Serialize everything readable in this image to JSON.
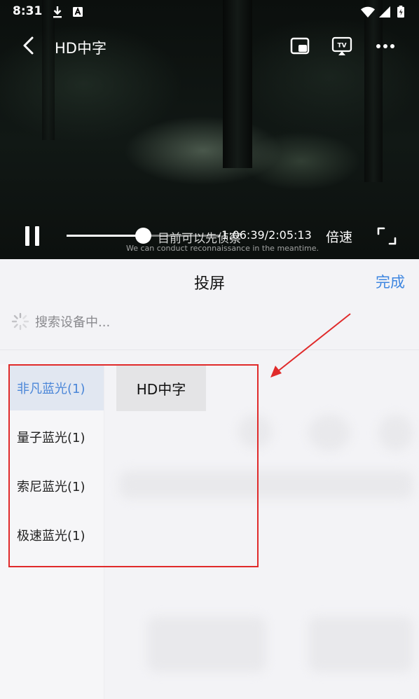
{
  "status_bar": {
    "time": "8:31"
  },
  "video": {
    "title": "HD中字",
    "subtitle_cn": "目前可以先侦察",
    "subtitle_en": "We can conduct reconnaissance in the meantime.",
    "current_time": "1:06:39",
    "duration": "2:05:13",
    "timecode": "1:06:39/2:05:13",
    "progress": 0.5326,
    "speed_label": "倍速"
  },
  "cast_sheet": {
    "title": "投屏",
    "done_label": "完成",
    "searching_text": "搜索设备中...",
    "categories": [
      {
        "label": "非凡蓝光(1)",
        "selected": true
      },
      {
        "label": "量子蓝光(1)",
        "selected": false
      },
      {
        "label": "索尼蓝光(1)",
        "selected": false
      },
      {
        "label": "极速蓝光(1)",
        "selected": false
      }
    ],
    "devices": [
      {
        "label": "HD中字"
      }
    ]
  },
  "colors": {
    "accent": "#3e86e0",
    "selected_text": "#4a86d8",
    "selected_bg": "#e1e7f1",
    "annotation": "#e02a2a"
  },
  "icons": {
    "download": "download-icon",
    "text_notification": "text-notification-icon",
    "wifi": "wifi-icon",
    "signal": "signal-icon",
    "battery": "battery-icon",
    "back": "back-arrow-icon",
    "picture_in_picture": "picture-in-picture-icon",
    "tv_cast": "tv-cast-icon",
    "more": "more-dots-icon",
    "pause": "pause-icon",
    "fullscreen": "fullscreen-icon",
    "loading": "loading-spinner-icon"
  }
}
